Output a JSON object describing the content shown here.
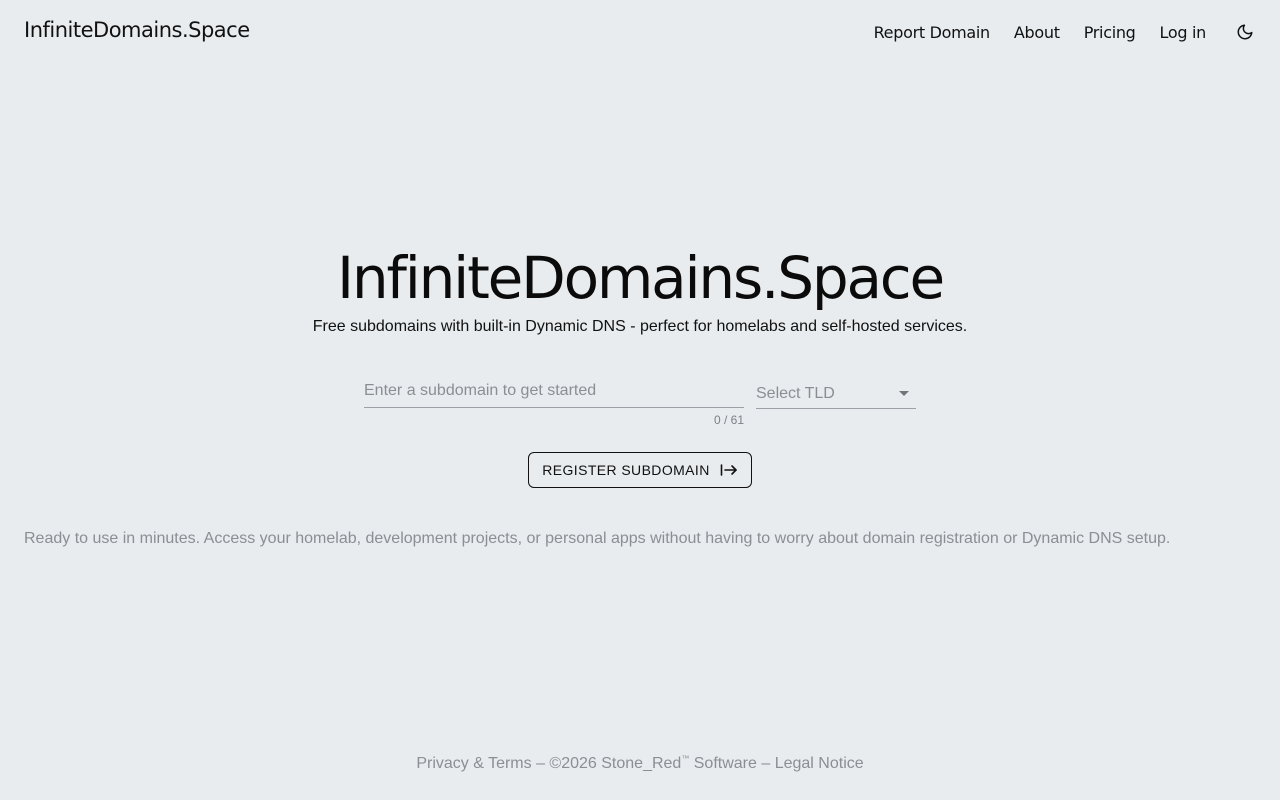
{
  "header": {
    "brand": "InfiniteDomains.Space",
    "nav": {
      "report_domain": "Report Domain",
      "about": "About",
      "pricing": "Pricing",
      "log_in": "Log in"
    },
    "theme_toggle_icon": "moon-icon"
  },
  "hero": {
    "title": "InfiniteDomains.Space",
    "subtitle": "Free subdomains with built-in Dynamic DNS - perfect for homelabs and self-hosted services."
  },
  "form": {
    "subdomain_placeholder": "Enter a subdomain to get started",
    "subdomain_value": "",
    "counter": "0 / 61",
    "tld_placeholder": "Select TLD",
    "register_label": "REGISTER SUBDOMAIN",
    "register_icon": "arrow-right-to-bar-icon"
  },
  "tagline": "Ready to use in minutes. Access your homelab, development projects, or personal apps without having to worry about domain registration or Dynamic DNS setup.",
  "footer": {
    "privacy_terms": "Privacy & Terms",
    "sep1": " – ",
    "copyright_prefix": "©2026 Stone_Red",
    "trademark": "™",
    "copyright_suffix": " Software",
    "sep2": " – ",
    "legal_notice": "Legal Notice"
  },
  "colors": {
    "background": "#e8ecef",
    "text": "#111111",
    "muted": "#8a8f94"
  }
}
